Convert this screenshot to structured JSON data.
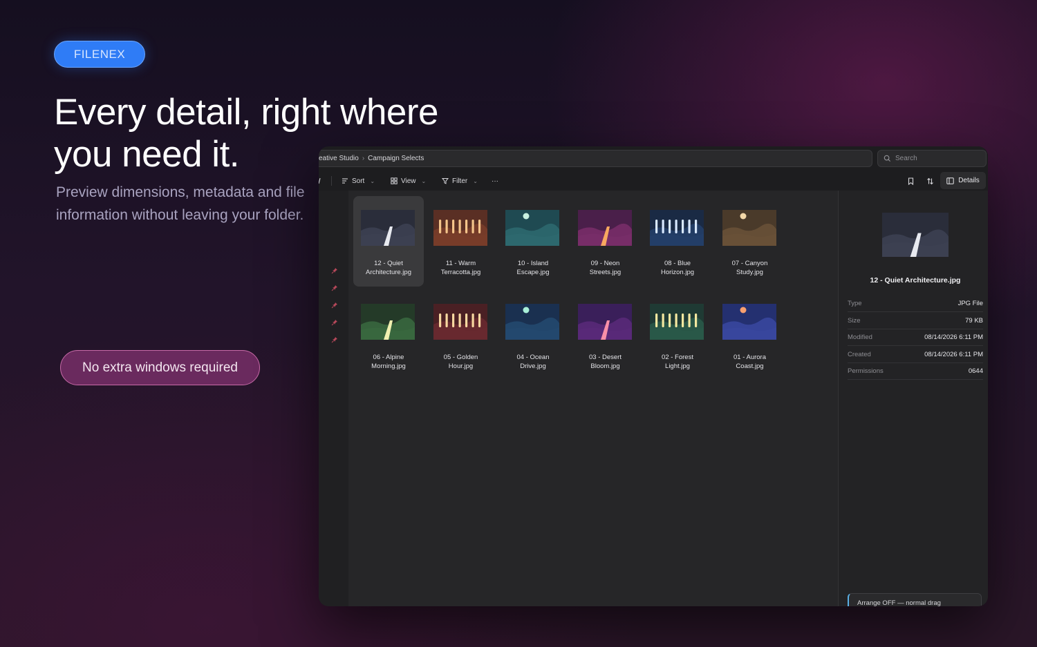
{
  "hero": {
    "brand": "FILENEX",
    "headline": "Every detail, right where you need it.",
    "subhead": "Preview dimensions, metadata and file information without leaving your folder.",
    "cta": "No extra windows required"
  },
  "window": {
    "breadcrumb": [
      "eative Studio",
      "Campaign Selects"
    ],
    "search_placeholder": "Search",
    "toolbar": {
      "sort_label": "Sort",
      "view_label": "View",
      "filter_label": "Filter",
      "more_label": "···",
      "details_label": "Details"
    },
    "files": [
      {
        "name": "12 - Quiet Architecture.jpg",
        "line1": "12 - Quiet",
        "line2": "Architecture.jpg",
        "style": "road",
        "sky": "#2a2d3a",
        "hill": "#3d4254",
        "accent": "#e8eaf0",
        "selected": true
      },
      {
        "name": "11 - Warm Terracotta.jpg",
        "line1": "11 - Warm",
        "line2": "Terracotta.jpg",
        "style": "bars",
        "sky": "#5a2f24",
        "hill": "#7a3d2a",
        "accent": "#f4c48a",
        "selected": false
      },
      {
        "name": "10 - Island Escape.jpg",
        "line1": "10 - Island",
        "line2": "Escape.jpg",
        "style": "sun",
        "sky": "#1f4a52",
        "hill": "#2e6a70",
        "accent": "#c8f0e0",
        "selected": false
      },
      {
        "name": "09 - Neon Streets.jpg",
        "line1": "09 - Neon",
        "line2": "Streets.jpg",
        "style": "road",
        "sky": "#4a1f4a",
        "hill": "#7a2e6a",
        "accent": "#f8a860",
        "selected": false
      },
      {
        "name": "08 - Blue Horizon.jpg",
        "line1": "08 - Blue",
        "line2": "Horizon.jpg",
        "style": "bars",
        "sky": "#1a2a44",
        "hill": "#24406a",
        "accent": "#d8e8ff",
        "selected": false
      },
      {
        "name": "07 - Canyon Study.jpg",
        "line1": "07 - Canyon",
        "line2": "Study.jpg",
        "style": "sun",
        "sky": "#4a3a2a",
        "hill": "#6a5238",
        "accent": "#f4d8a8",
        "selected": false
      },
      {
        "name": "06 - Alpine Morning.jpg",
        "line1": "06 - Alpine",
        "line2": "Morning.jpg",
        "style": "road",
        "sky": "#243a28",
        "hill": "#3a6a40",
        "accent": "#f0f0b0",
        "selected": false
      },
      {
        "name": "05 - Golden Hour.jpg",
        "line1": "05 - Golden",
        "line2": "Hour.jpg",
        "style": "bars",
        "sky": "#4a2024",
        "hill": "#6a2a30",
        "accent": "#f8d8a0",
        "selected": false
      },
      {
        "name": "04 - Ocean Drive.jpg",
        "line1": "04 - Ocean",
        "line2": "Drive.jpg",
        "style": "sun",
        "sky": "#1a3050",
        "hill": "#244a70",
        "accent": "#a8f0d8",
        "selected": false
      },
      {
        "name": "03 - Desert Bloom.jpg",
        "line1": "03 - Desert",
        "line2": "Bloom.jpg",
        "style": "road",
        "sky": "#3a1f5a",
        "hill": "#5a2a7a",
        "accent": "#f890a8",
        "selected": false
      },
      {
        "name": "02 - Forest Light.jpg",
        "line1": "02 - Forest",
        "line2": "Light.jpg",
        "style": "bars",
        "sky": "#1f3a34",
        "hill": "#2a5a4a",
        "accent": "#f4e8a0",
        "selected": false
      },
      {
        "name": "01 - Aurora Coast.jpg",
        "line1": "01 - Aurora",
        "line2": "Coast.jpg",
        "style": "sun",
        "sky": "#243070",
        "hill": "#3a48a0",
        "accent": "#f8a070",
        "selected": false
      }
    ],
    "details": {
      "preview_name": "12 - Quiet Architecture.jpg",
      "rows": [
        {
          "key": "Type",
          "value": "JPG File"
        },
        {
          "key": "Size",
          "value": "79 KB"
        },
        {
          "key": "Modified",
          "value": "08/14/2026 6:11 PM"
        },
        {
          "key": "Created",
          "value": "08/14/2026 6:11 PM"
        },
        {
          "key": "Permissions",
          "value": "0644"
        }
      ],
      "status": "Arrange OFF — normal drag"
    }
  }
}
